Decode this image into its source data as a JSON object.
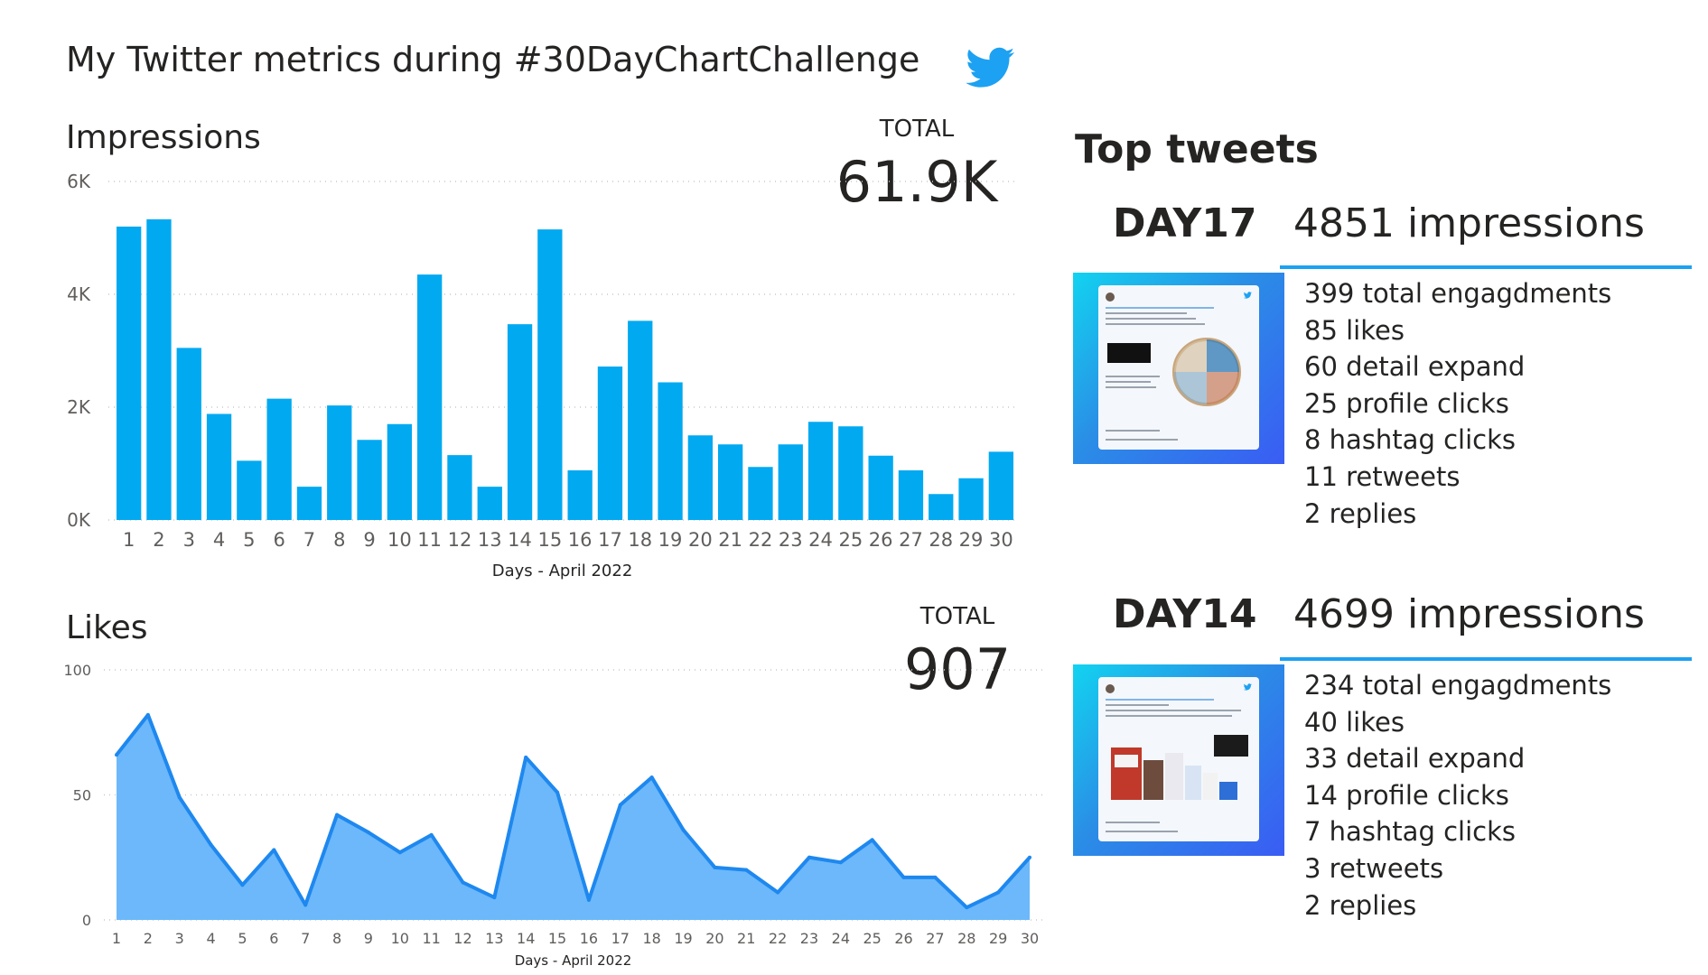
{
  "page_title": "My Twitter metrics during #30DayChartChallenge",
  "icons": {
    "twitter": "twitter-bird-icon"
  },
  "colors": {
    "bar": "#01a9f1",
    "area_fill": "#6cb8fb",
    "area_line": "#1e88ef",
    "accent": "#1da1f2"
  },
  "impressions": {
    "title": "Impressions",
    "total_label": "TOTAL",
    "total_value": "61.9K"
  },
  "likes": {
    "title": "Likes",
    "total_label": "TOTAL",
    "total_value": "907"
  },
  "chart_data": [
    {
      "type": "bar",
      "title": "Impressions",
      "xlabel": "Days - April 2022",
      "ylabel": "",
      "categories": [
        "1",
        "2",
        "3",
        "4",
        "5",
        "6",
        "7",
        "8",
        "9",
        "10",
        "11",
        "12",
        "13",
        "14",
        "15",
        "16",
        "17",
        "18",
        "19",
        "20",
        "21",
        "22",
        "23",
        "24",
        "25",
        "26",
        "27",
        "28",
        "29",
        "30"
      ],
      "values": [
        5200,
        5330,
        3050,
        1880,
        1050,
        2150,
        590,
        2030,
        1420,
        1700,
        4350,
        1150,
        590,
        3470,
        5150,
        880,
        2720,
        3530,
        2440,
        1500,
        1340,
        940,
        1340,
        1740,
        1660,
        1140,
        880,
        460,
        740,
        1210
      ],
      "ylim": [
        0,
        6000
      ],
      "yticks": [
        0,
        2000,
        4000,
        6000
      ],
      "ytick_labels": [
        "0K",
        "2K",
        "4K",
        "6K"
      ],
      "grid": true
    },
    {
      "type": "area",
      "title": "Likes",
      "xlabel": "Days - April 2022",
      "ylabel": "",
      "categories": [
        "1",
        "2",
        "3",
        "4",
        "5",
        "6",
        "7",
        "8",
        "9",
        "10",
        "11",
        "12",
        "13",
        "14",
        "15",
        "16",
        "17",
        "18",
        "19",
        "20",
        "21",
        "22",
        "23",
        "24",
        "25",
        "26",
        "27",
        "28",
        "29",
        "30"
      ],
      "values": [
        66,
        82,
        49,
        30,
        14,
        28,
        6,
        42,
        35,
        27,
        34,
        15,
        9,
        65,
        51,
        8,
        46,
        57,
        36,
        21,
        20,
        11,
        25,
        23,
        32,
        17,
        17,
        5,
        11,
        25
      ],
      "ylim": [
        0,
        100
      ],
      "yticks": [
        0,
        50,
        100
      ],
      "ytick_labels": [
        "0",
        "50",
        "100"
      ],
      "grid": true
    }
  ],
  "top_tweets": {
    "title": "Top tweets",
    "tweets": [
      {
        "day": "DAY17",
        "impressions": "4851 impressions",
        "stats": [
          "399 total engagdments",
          "85 likes",
          "60 detail expand",
          "25 profile clicks",
          "8 hashtag clicks",
          "11 retweets",
          "2 replies"
        ],
        "thumbnail": "tweet-screenshot-star-wars"
      },
      {
        "day": "DAY14",
        "impressions": "4699 impressions",
        "stats": [
          "234 total engagdments",
          "40 likes",
          "33 detail expand",
          "14 profile clicks",
          "7 hashtag clicks",
          "3 retweets",
          "2 replies"
        ],
        "thumbnail": "tweet-screenshot-milk-calories"
      }
    ]
  }
}
